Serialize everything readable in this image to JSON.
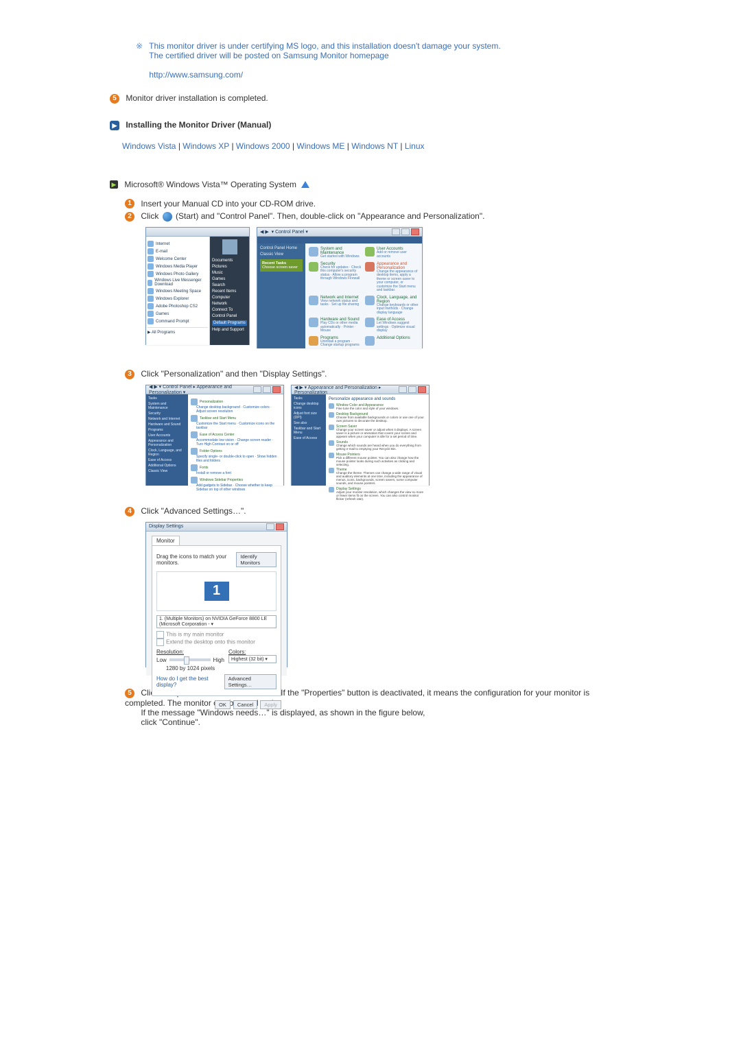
{
  "note": {
    "line1": "This monitor driver is under certifying MS logo, and this installation doesn't damage your system.",
    "line2": "The certified driver will be posted on Samsung Monitor homepage",
    "url": "http://www.samsung.com/"
  },
  "step5": "Monitor driver installation is completed.",
  "manual_header": "Installing the Monitor Driver (Manual)",
  "os_links": {
    "vista": "Windows Vista",
    "xp": "Windows XP",
    "w2000": "Windows 2000",
    "me": "Windows ME",
    "nt": "Windows NT",
    "linux": "Linux"
  },
  "vista_title": "Microsoft® Windows Vista™ Operating System",
  "steps": {
    "s1": "Insert your Manual CD into your CD-ROM drive.",
    "s2_a": "Click ",
    "s2_b": "(Start) and \"Control Panel\". Then, double-click on \"Appearance and Personalization\".",
    "s3": "Click \"Personalization\" and then \"Display Settings\".",
    "s4": "Click \"Advanced Settings…\".",
    "s5_a": "Click \"Properties\" in the \"Monitor\" tab. If the \"Properties\" button is deactivated, it means the configuration for your monitor is completed. The monitor can be used as is.",
    "s5_b": "If the message \"Windows needs…\" is displayed, as shown in the figure below,",
    "s5_c": "click \"Continue\"."
  },
  "bullets": {
    "b1": "1",
    "b2": "2",
    "b3": "3",
    "b4": "4",
    "b5": "5"
  },
  "startmenu": {
    "items": [
      "Internet",
      "E-mail",
      "Welcome Center",
      "Windows Media Player",
      "Windows Photo Gallery",
      "Windows Live Messenger Download",
      "Windows Meeting Space",
      "Windows Explorer",
      "Adobe Photoshop CS2",
      "Games",
      "Command Prompt"
    ],
    "all": "All Programs",
    "right": [
      "Documents",
      "Pictures",
      "Music",
      "Games",
      "Search",
      "Recent Items",
      "Computer",
      "Network",
      "Connect To",
      "Control Panel",
      "Default Programs",
      "Help and Support"
    ],
    "right_highlight_index": 10
  },
  "controlpanel": {
    "breadcrumb": "Control Panel",
    "side_title": "Control Panel Home",
    "side_sub": "Classic View",
    "green_title": "Recent Tasks",
    "green_sub": "Choose screen saver",
    "items": [
      {
        "name": "System and Maintenance",
        "sub": "Get started with Windows",
        "hot": false,
        "ic": ""
      },
      {
        "name": "User Accounts",
        "sub": "Add or remove user accounts",
        "hot": false,
        "ic": "grn"
      },
      {
        "name": "Security",
        "sub": "Check for updates · Check this computer's security status · Allow a program through Windows Firewall",
        "hot": false,
        "ic": "grn"
      },
      {
        "name": "Appearance and Personalization",
        "sub": "Change the appearance of desktop items, apply a theme or screen saver to your computer, or customize the Start menu and taskbar.",
        "hot": true,
        "ic": "red"
      },
      {
        "name": "Network and Internet",
        "sub": "View network status and tasks · Set up file sharing",
        "hot": false,
        "ic": ""
      },
      {
        "name": "Clock, Language, and Region",
        "sub": "Change keyboards or other input methods · Change display language",
        "hot": false,
        "ic": ""
      },
      {
        "name": "Hardware and Sound",
        "sub": "Play CDs or other media automatically · Printer · Mouse",
        "hot": false,
        "ic": ""
      },
      {
        "name": "Ease of Access",
        "sub": "Let Windows suggest settings · Optimize visual display",
        "hot": false,
        "ic": ""
      },
      {
        "name": "Programs",
        "sub": "Uninstall a program · Change startup programs",
        "hot": false,
        "ic": "org"
      },
      {
        "name": "Additional Options",
        "sub": "",
        "hot": false,
        "ic": ""
      }
    ]
  },
  "appearance": {
    "side": [
      "Tasks",
      "System and Maintenance",
      "Security",
      "Network and Internet",
      "Hardware and Sound",
      "Programs",
      "User Accounts",
      "Appearance and Personalization",
      "Clock, Language, and Region",
      "Ease of Access",
      "Additional Options",
      "Classic View"
    ],
    "main": [
      {
        "t": "Personalization",
        "s": "Change desktop background · Customize colors · Adjust screen resolution"
      },
      {
        "t": "Taskbar and Start Menu",
        "s": "Customize the Start menu · Customize icons on the taskbar"
      },
      {
        "t": "Ease of Access Center",
        "s": "Accommodate low vision · Change screen reader · Turn High Contrast on or off"
      },
      {
        "t": "Folder Options",
        "s": "Specify single- or double-click to open · Show hidden files and folders"
      },
      {
        "t": "Fonts",
        "s": "Install or remove a font"
      },
      {
        "t": "Windows Sidebar Properties",
        "s": "Add gadgets to Sidebar · Choose whether to keep Sidebar on top of other windows"
      }
    ]
  },
  "personalization": {
    "side": [
      "Tasks",
      "Change desktop icons",
      "Adjust font size (DPI)",
      "See also",
      "Taskbar and Start Menu",
      "Ease of Access"
    ],
    "header": "Personalize appearance and sounds",
    "items": [
      {
        "t": "Window Color and Appearance",
        "d": "Fine tune the color and style of your windows."
      },
      {
        "t": "Desktop Background",
        "d": "Choose from available backgrounds or colors or use one of your own pictures to decorate the desktop."
      },
      {
        "t": "Screen Saver",
        "d": "Change your screen saver or adjust when it displays. A screen saver is a picture or animation that covers your screen and appears when your computer is idle for a set period of time."
      },
      {
        "t": "Sounds",
        "d": "Change which sounds are heard when you do everything from getting e-mail to emptying your Recycle Bin."
      },
      {
        "t": "Mouse Pointers",
        "d": "Pick a different mouse pointer. You can also change how the mouse pointer looks during such activities as clicking and selecting."
      },
      {
        "t": "Theme",
        "d": "Change the theme. Themes can change a wide range of visual and auditory elements at one time, including the appearance of menus, icons, backgrounds, screen savers, some computer sounds, and mouse pointers."
      },
      {
        "t": "Display Settings",
        "d": "Adjust your monitor resolution, which changes the view so more or fewer items fit on the screen. You can also control monitor flicker (refresh rate)."
      }
    ]
  },
  "display_settings": {
    "title": "Display Settings",
    "tab": "Monitor",
    "drag": "Drag the icons to match your monitors.",
    "identify": "Identify Monitors",
    "mon_num": "1",
    "device": "1. (Multiple Monitors) on NVIDIA GeForce 8800 LE (Microsoft Corporation - ▾",
    "chk1": "This is my main monitor",
    "chk2": "Extend the desktop onto this monitor",
    "resolution_label": "Resolution:",
    "low": "Low",
    "high": "High",
    "res": "1280 by 1024 pixels",
    "colors_label": "Colors:",
    "colors_val": "Highest (32 bit)   ▾",
    "best": "How do I get the best display?",
    "advanced": "Advanced Settings…",
    "ok": "OK",
    "cancel": "Cancel",
    "apply": "Apply"
  }
}
